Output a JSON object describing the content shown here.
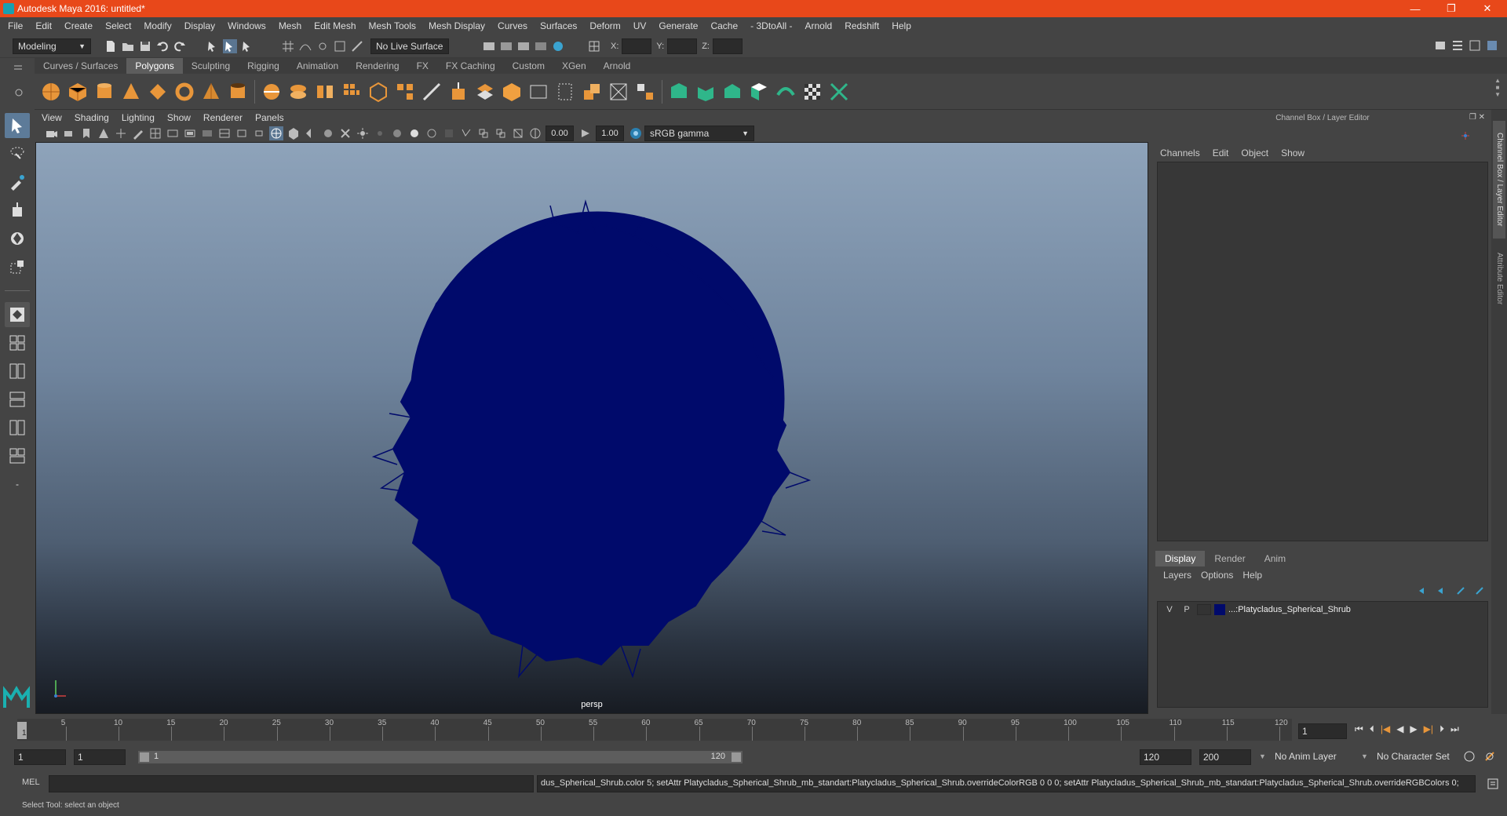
{
  "title_bar": {
    "app_title": "Autodesk Maya 2016: untitled*",
    "minimize": "—",
    "restore": "❐",
    "close": "✕"
  },
  "menu": [
    "File",
    "Edit",
    "Create",
    "Select",
    "Modify",
    "Display",
    "Windows",
    "Mesh",
    "Edit Mesh",
    "Mesh Tools",
    "Mesh Display",
    "Curves",
    "Surfaces",
    "Deform",
    "UV",
    "Generate",
    "Cache",
    "- 3DtoAll -",
    "Arnold",
    "Redshift",
    "Help"
  ],
  "status_line": {
    "mode": "Modeling",
    "live_surface": "No Live Surface",
    "x_label": "X:",
    "y_label": "Y:",
    "z_label": "Z:"
  },
  "shelf_tabs": [
    "Curves / Surfaces",
    "Polygons",
    "Sculpting",
    "Rigging",
    "Animation",
    "Rendering",
    "FX",
    "FX Caching",
    "Custom",
    "XGen",
    "Arnold"
  ],
  "shelf_active": "Polygons",
  "viewport": {
    "menu": [
      "View",
      "Shading",
      "Lighting",
      "Show",
      "Renderer",
      "Panels"
    ],
    "exposure": "0.00",
    "gamma": "1.00",
    "color_space": "sRGB gamma",
    "camera_label": "persp",
    "object_color": "#000a6b"
  },
  "channel_box": {
    "title": "Channel Box / Layer Editor",
    "menu": [
      "Channels",
      "Edit",
      "Object",
      "Show"
    ],
    "side_tab_1": "Channel Box / Layer Editor",
    "side_tab_2": "Attribute Editor"
  },
  "layer_editor": {
    "tabs": [
      "Display",
      "Render",
      "Anim"
    ],
    "active_tab": "Display",
    "menu": [
      "Layers",
      "Options",
      "Help"
    ],
    "layers": [
      {
        "v": "V",
        "p": "P",
        "name": "...:Platycladus_Spherical_Shrub",
        "color": "#000a6b"
      }
    ]
  },
  "timeline": {
    "ticks": [
      "1",
      "5",
      "10",
      "15",
      "20",
      "25",
      "30",
      "35",
      "40",
      "45",
      "50",
      "55",
      "60",
      "65",
      "70",
      "75",
      "80",
      "85",
      "90",
      "95",
      "100",
      "105",
      "110",
      "115",
      "120"
    ],
    "current_frame": "1"
  },
  "range": {
    "start": "1",
    "start2": "1",
    "slider_start": "1",
    "slider_end": "120",
    "end": "120",
    "end2": "200",
    "anim_layer": "No Anim Layer",
    "char_set": "No Character Set"
  },
  "command": {
    "label": "MEL",
    "output": "dus_Spherical_Shrub.color 5; setAttr Platycladus_Spherical_Shrub_mb_standart:Platycladus_Spherical_Shrub.overrideColorRGB 0 0 0; setAttr Platycladus_Spherical_Shrub_mb_standart:Platycladus_Spherical_Shrub.overrideRGBColors 0;"
  },
  "help_line": "Select Tool: select an object"
}
